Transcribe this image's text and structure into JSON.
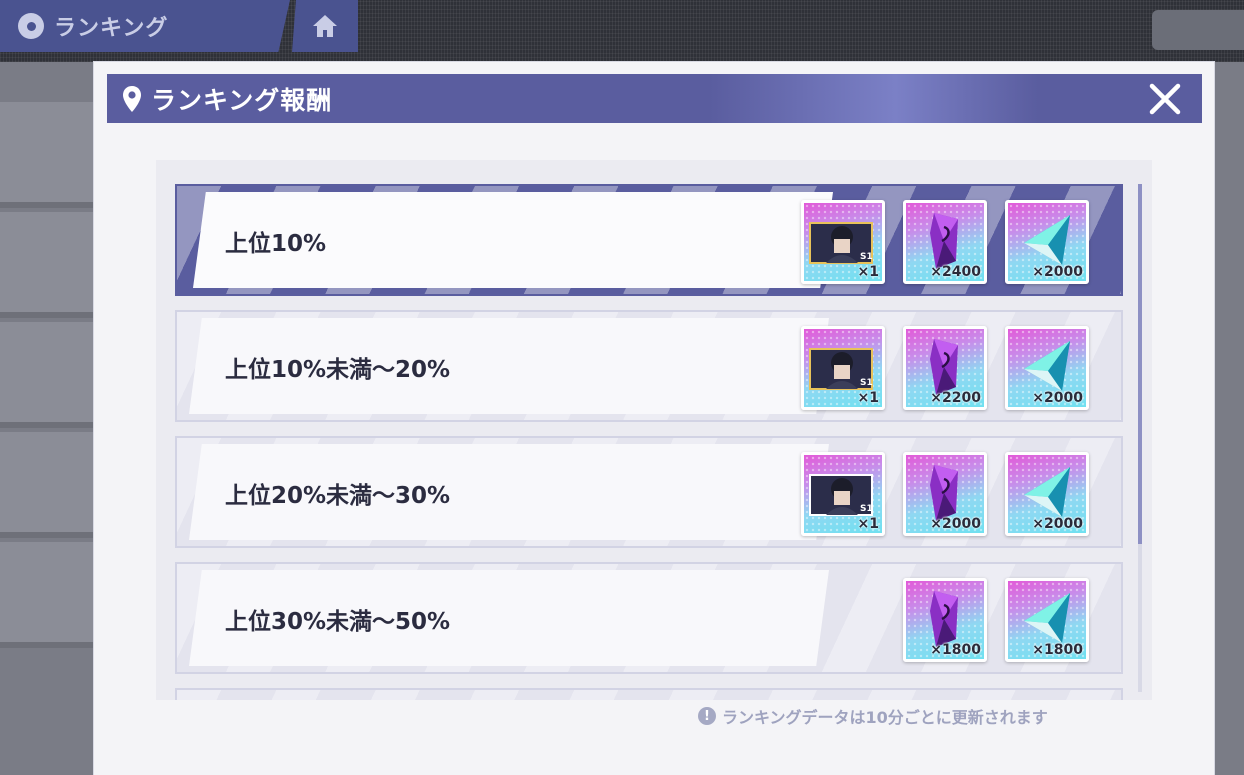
{
  "background": {
    "tab_label": "ランキング"
  },
  "modal": {
    "title": "ランキング報酬",
    "footer_note": "ランキングデータは10分ごとに更新されます"
  },
  "rows": [
    {
      "label": "上位10%",
      "highlighted": true,
      "rewards": [
        {
          "icon": "character-card-icon",
          "qty": "×1"
        },
        {
          "icon": "purple-crystal-icon",
          "qty": "×2400"
        },
        {
          "icon": "blue-crystal-icon",
          "qty": "×2000"
        }
      ]
    },
    {
      "label": "上位10%未満～20%",
      "highlighted": false,
      "rewards": [
        {
          "icon": "character-card-icon",
          "qty": "×1"
        },
        {
          "icon": "purple-crystal-icon",
          "qty": "×2200"
        },
        {
          "icon": "blue-crystal-icon",
          "qty": "×2000"
        }
      ]
    },
    {
      "label": "上位20%未満～30%",
      "highlighted": false,
      "rewards": [
        {
          "icon": "character-card-icon",
          "qty": "×1"
        },
        {
          "icon": "purple-crystal-icon",
          "qty": "×2000"
        },
        {
          "icon": "blue-crystal-icon",
          "qty": "×2000"
        }
      ]
    },
    {
      "label": "上位30%未満～50%",
      "highlighted": false,
      "rewards": [
        {
          "icon": "purple-crystal-icon",
          "qty": "×1800"
        },
        {
          "icon": "blue-crystal-icon",
          "qty": "×1800"
        }
      ]
    }
  ],
  "colors": {
    "header": "#5a5d9f",
    "highlight_row": "#5a5d9f",
    "text_dark": "#2b2c40"
  }
}
